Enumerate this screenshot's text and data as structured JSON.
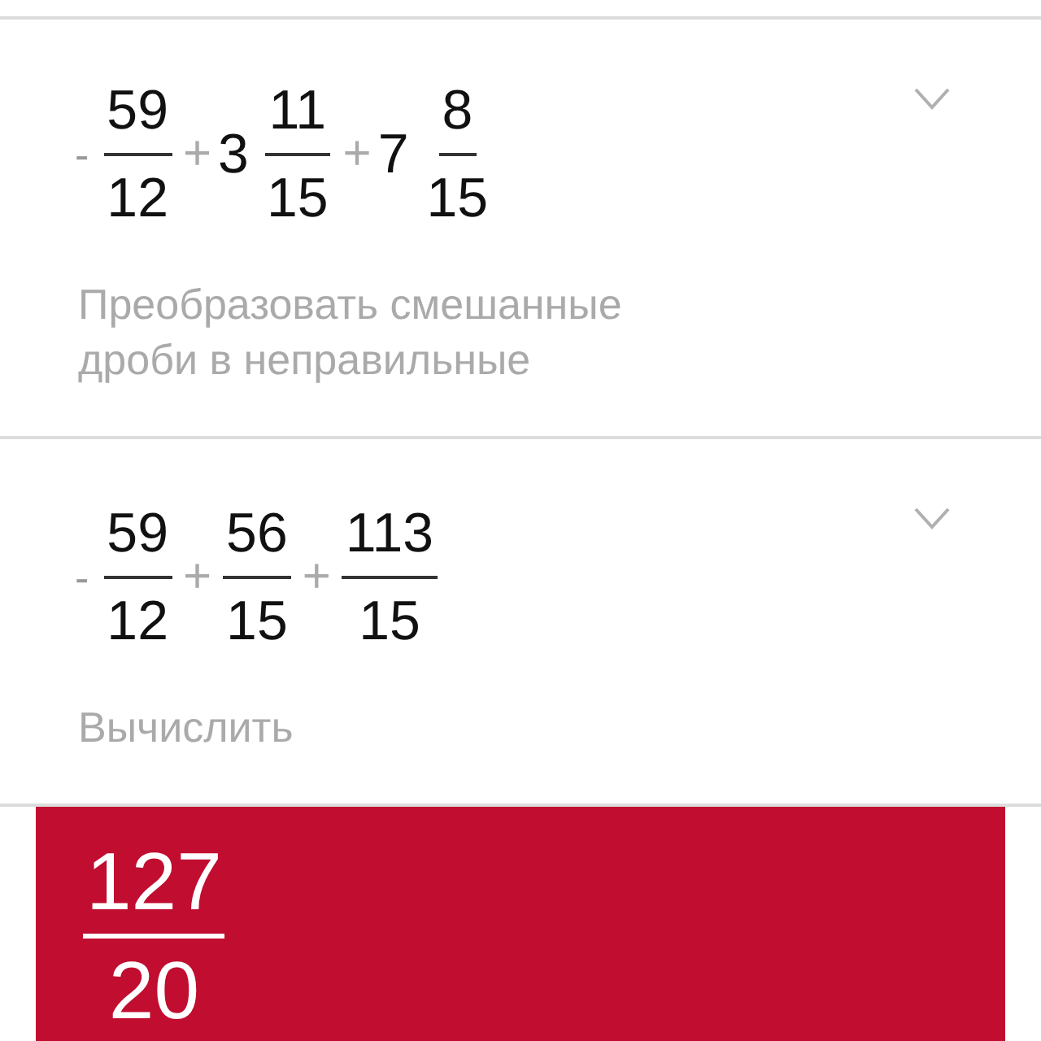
{
  "steps": [
    {
      "expanded": false,
      "expression": [
        {
          "kind": "sign",
          "text": "-"
        },
        {
          "kind": "fraction",
          "numerator": "59",
          "denominator": "12"
        },
        {
          "kind": "operator",
          "text": "+"
        },
        {
          "kind": "mixed",
          "whole": "3",
          "numerator": "11",
          "denominator": "15"
        },
        {
          "kind": "operator",
          "text": "+"
        },
        {
          "kind": "mixed",
          "whole": "7",
          "numerator": "8",
          "denominator": "15"
        }
      ],
      "description": "Преобразовать смешанные дроби в неправильные"
    },
    {
      "expanded": false,
      "expression": [
        {
          "kind": "sign",
          "text": "-"
        },
        {
          "kind": "fraction",
          "numerator": "59",
          "denominator": "12"
        },
        {
          "kind": "operator",
          "text": "+"
        },
        {
          "kind": "fraction",
          "numerator": "56",
          "denominator": "15"
        },
        {
          "kind": "operator",
          "text": "+"
        },
        {
          "kind": "fraction",
          "numerator": "113",
          "denominator": "15"
        }
      ],
      "description": "Вычислить"
    }
  ],
  "result": {
    "numerator": "127",
    "denominator": "20"
  }
}
